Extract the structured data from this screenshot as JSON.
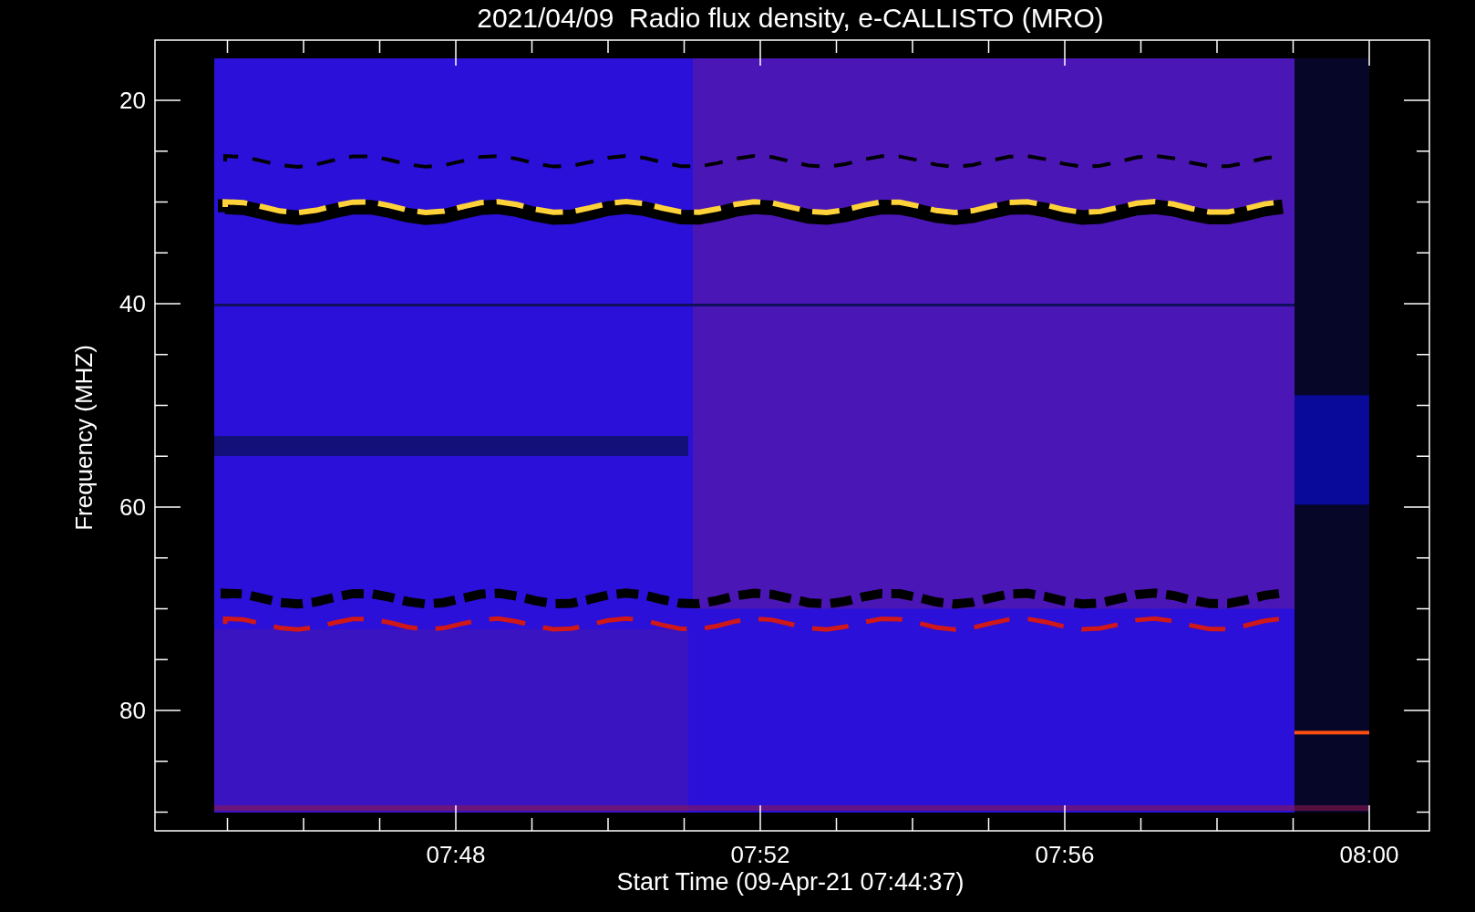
{
  "title": "2021/04/09  Radio flux density, e-CALLISTO (MRO)",
  "y_axis": {
    "label": "Frequency (MHZ)",
    "ticks": [
      "20",
      "40",
      "60",
      "80"
    ]
  },
  "x_axis": {
    "label": "Start Time (09-Apr-21 07:44:37)",
    "ticks": [
      "07:48",
      "07:52",
      "07:56",
      "08:00"
    ]
  }
}
